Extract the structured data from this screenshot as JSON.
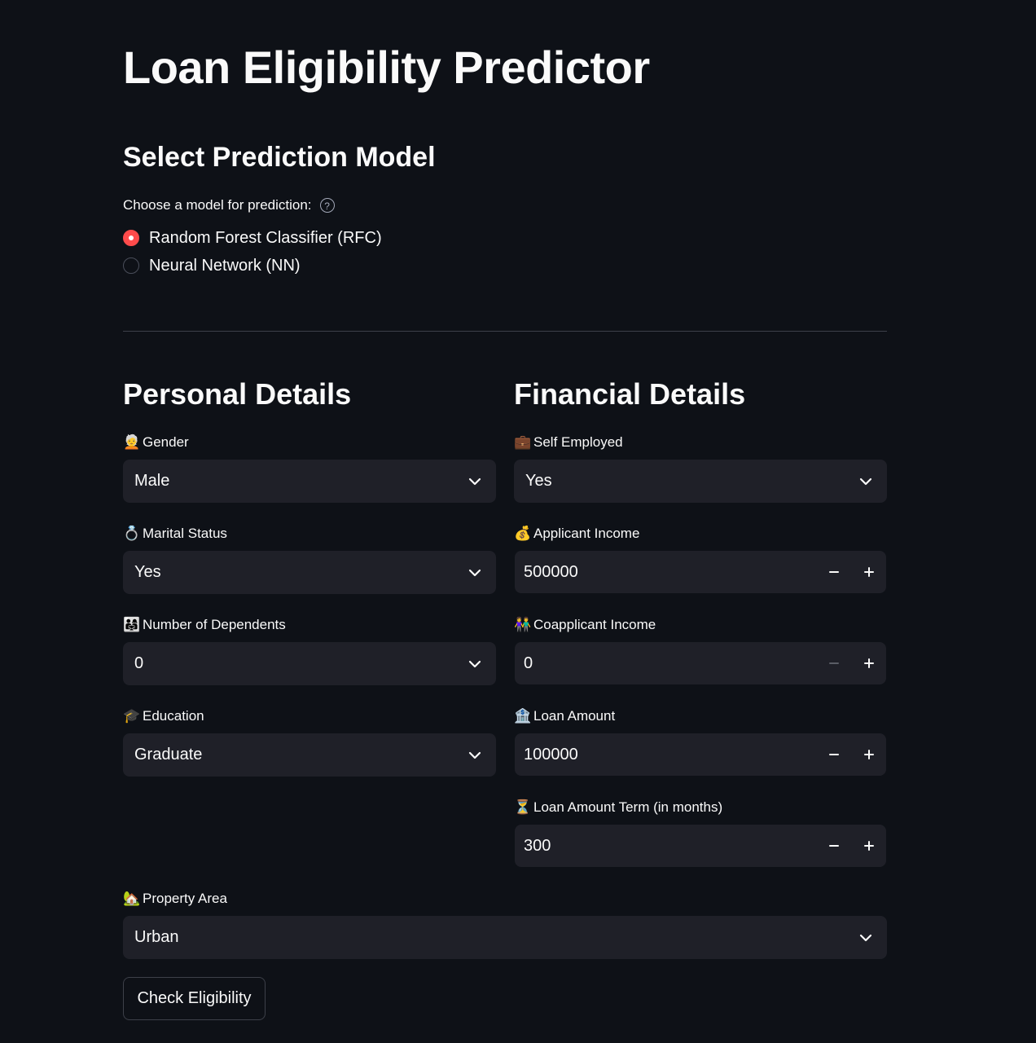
{
  "title": "Loan Eligibility Predictor",
  "model_section": {
    "heading": "Select Prediction Model",
    "question": "Choose a model for prediction:",
    "help_icon": "?",
    "options": [
      {
        "label": "Random Forest Classifier (RFC)",
        "selected": true
      },
      {
        "label": "Neural Network (NN)",
        "selected": false
      }
    ]
  },
  "personal": {
    "heading": "Personal Details",
    "gender": {
      "emoji": "🧑‍🦳",
      "label": "Gender",
      "value": "Male"
    },
    "marital": {
      "emoji": "💍",
      "label": "Marital Status",
      "value": "Yes"
    },
    "dependents": {
      "emoji": "👨‍👩‍👧",
      "label": "Number of Dependents",
      "value": "0"
    },
    "education": {
      "emoji": "🎓",
      "label": "Education",
      "value": "Graduate"
    }
  },
  "financial": {
    "heading": "Financial Details",
    "self_employed": {
      "emoji": "💼",
      "label": "Self Employed",
      "value": "Yes"
    },
    "applicant_income": {
      "emoji": "💰",
      "label": "Applicant Income",
      "value": "500000"
    },
    "coapplicant_income": {
      "emoji": "👫",
      "label": "Coapplicant Income",
      "value": "0"
    },
    "loan_amount": {
      "emoji": "🏦",
      "label": "Loan Amount",
      "value": "100000"
    },
    "loan_term": {
      "emoji": "⏳",
      "label": "Loan Amount Term (in months)",
      "value": "300"
    }
  },
  "property": {
    "emoji": "🏡",
    "label": "Property Area",
    "value": "Urban"
  },
  "submit_label": "Check Eligibility",
  "colors": {
    "background": "#0e1117",
    "input_bg": "#1f2028",
    "accent": "#ff4b4b",
    "text": "#fafafa",
    "divider": "#3d4049"
  },
  "icons": {
    "chevron": "chevron-down-icon",
    "minus": "minus-icon",
    "plus": "plus-icon",
    "help": "help-circle-icon"
  }
}
